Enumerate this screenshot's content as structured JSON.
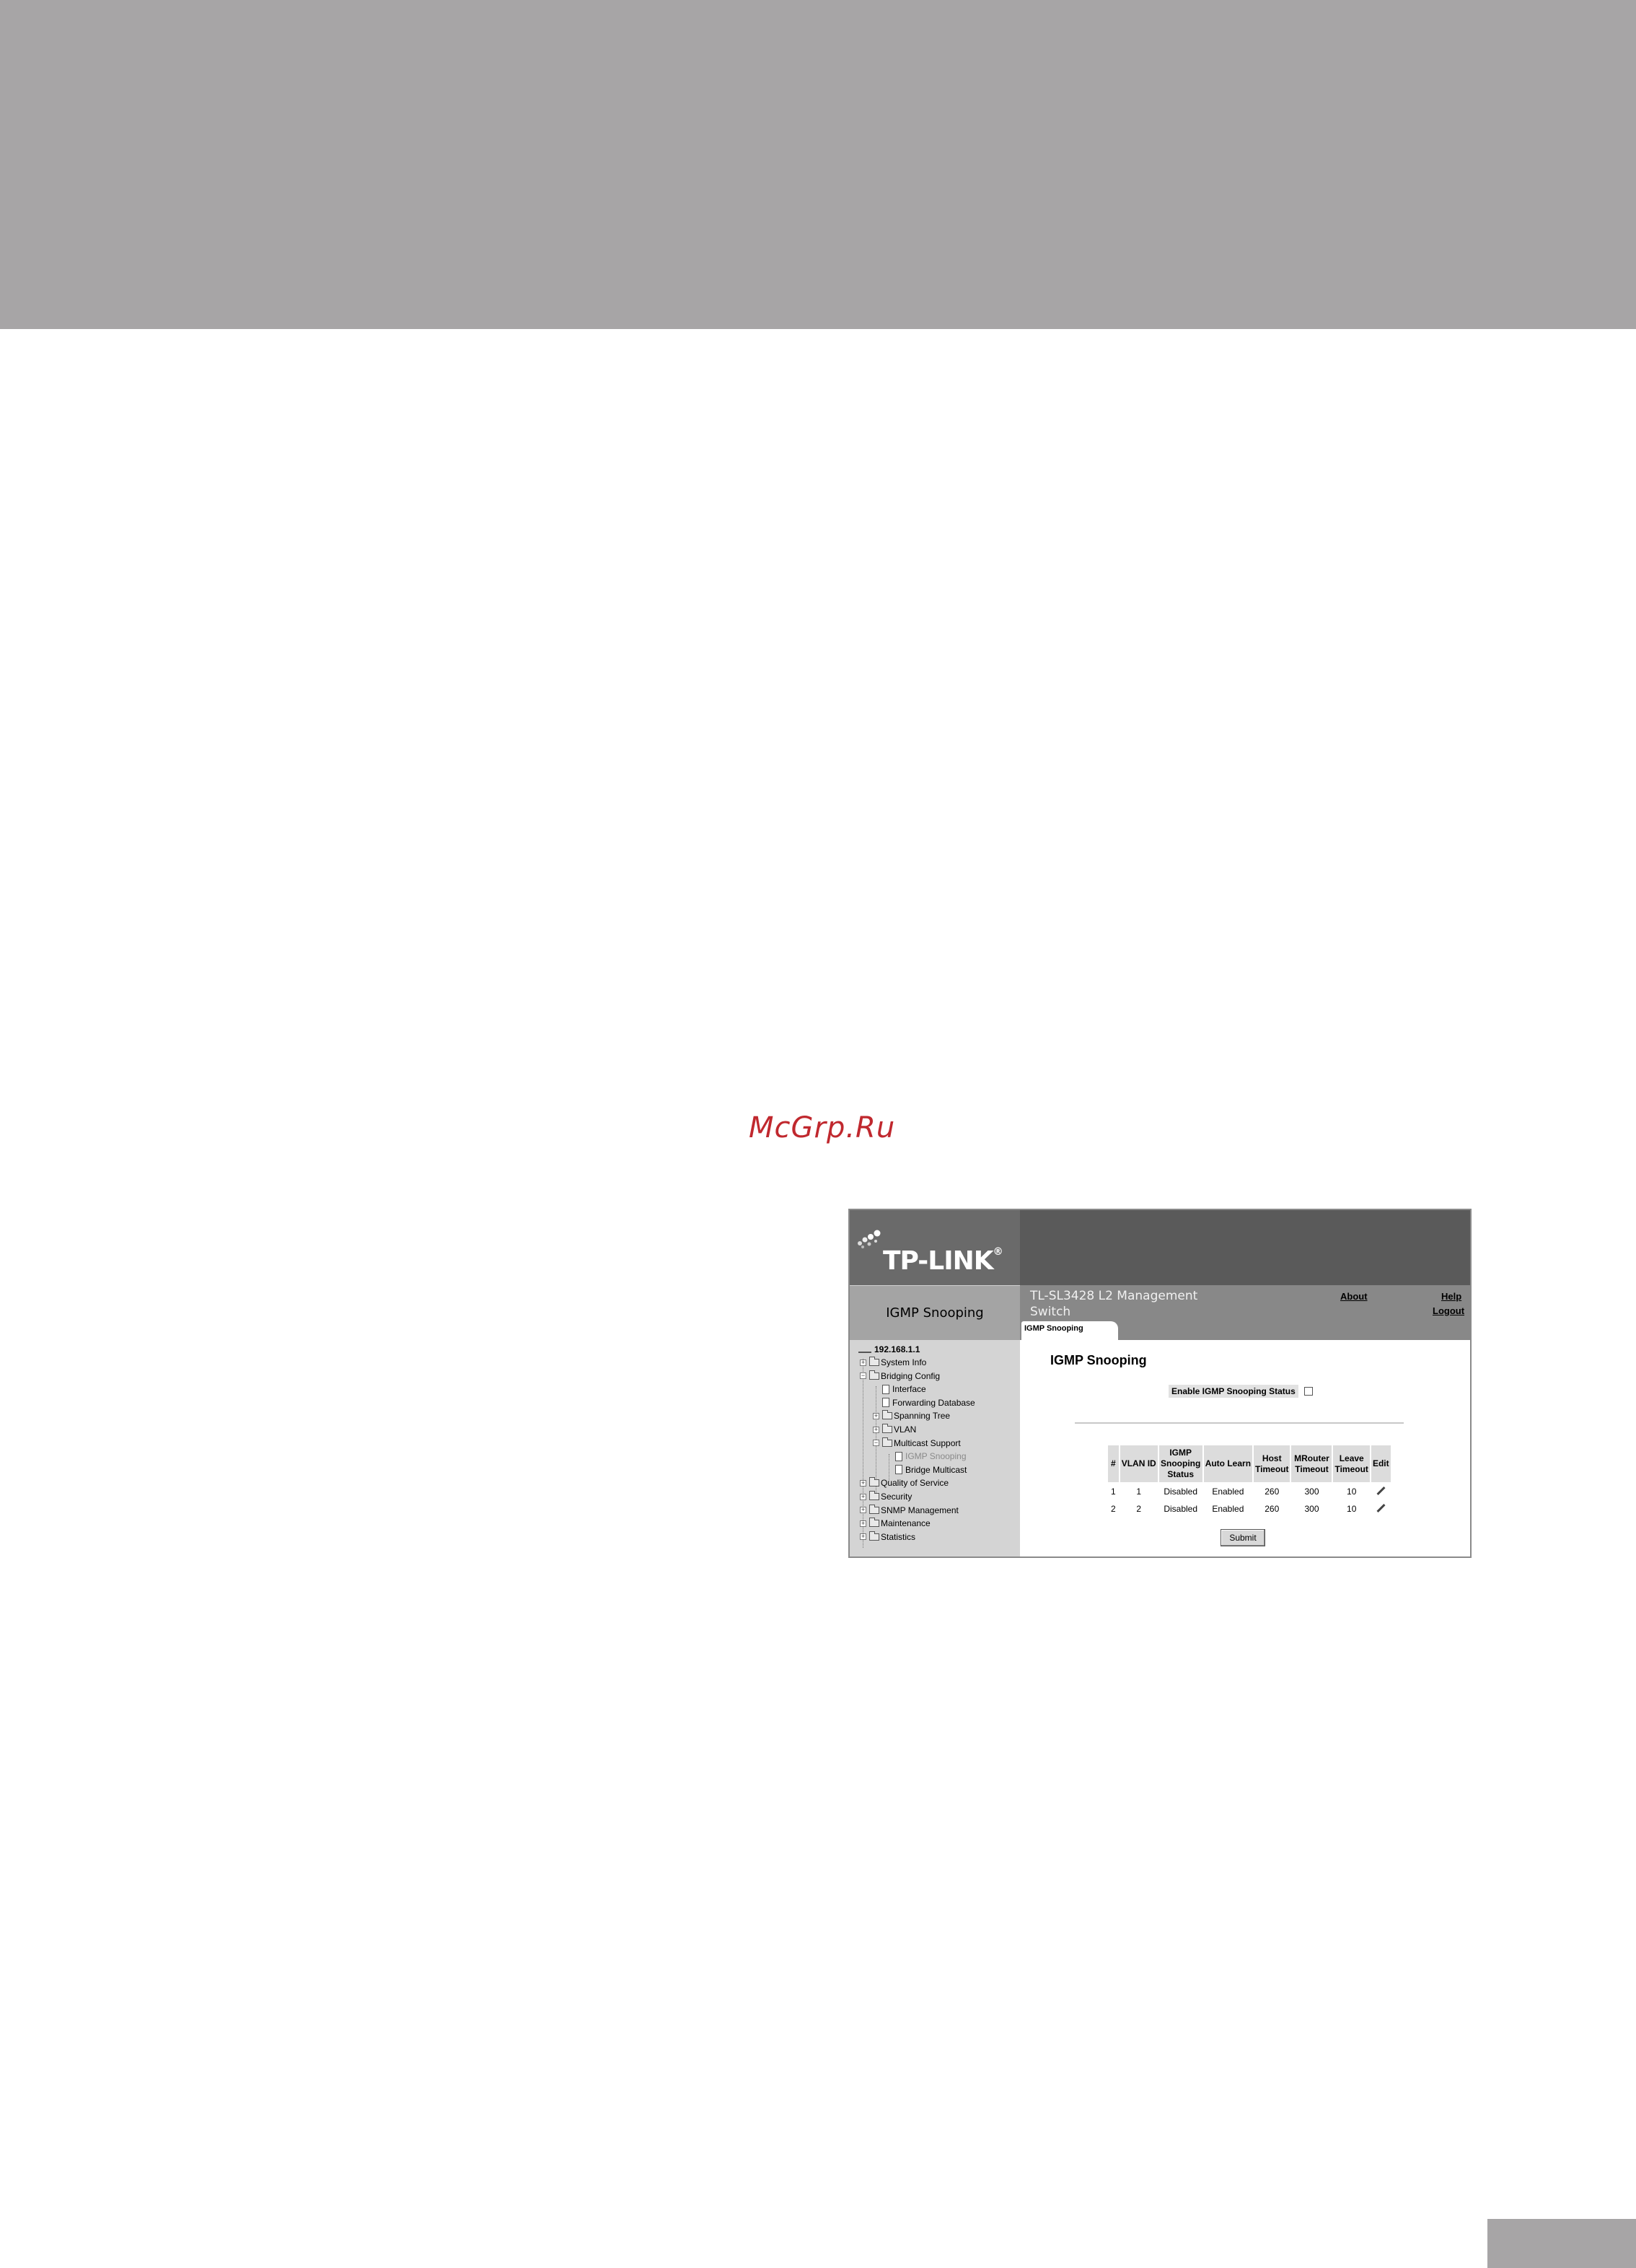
{
  "watermark": "McGrp.Ru",
  "app": {
    "logo": "TP-LINK",
    "logo_mark": "®",
    "page_name": "IGMP Snooping",
    "product": "TL-SL3428 L2 Management Switch",
    "links": {
      "about": "About",
      "help": "Help",
      "logout": "Logout"
    },
    "tab": "IGMP Snooping"
  },
  "sidebar": {
    "root": "192.168.1.1",
    "items": [
      {
        "label": "System Info",
        "level": 0,
        "type": "folder",
        "expander": "+"
      },
      {
        "label": "Bridging Config",
        "level": 0,
        "type": "folder",
        "expander": "−"
      },
      {
        "label": "Interface",
        "level": 1,
        "type": "page"
      },
      {
        "label": "Forwarding Database",
        "level": 1,
        "type": "page"
      },
      {
        "label": "Spanning Tree",
        "level": 1,
        "type": "folder",
        "expander": "+"
      },
      {
        "label": "VLAN",
        "level": 1,
        "type": "folder",
        "expander": "+"
      },
      {
        "label": "Multicast Support",
        "level": 1,
        "type": "folder",
        "expander": "−"
      },
      {
        "label": "IGMP Snooping",
        "level": 2,
        "type": "page",
        "selected": true
      },
      {
        "label": "Bridge Multicast",
        "level": 2,
        "type": "page"
      },
      {
        "label": "Quality of Service",
        "level": 0,
        "type": "folder",
        "expander": "+"
      },
      {
        "label": "Security",
        "level": 0,
        "type": "folder",
        "expander": "+"
      },
      {
        "label": "SNMP Management",
        "level": 0,
        "type": "folder",
        "expander": "+"
      },
      {
        "label": "Maintenance",
        "level": 0,
        "type": "folder",
        "expander": "+"
      },
      {
        "label": "Statistics",
        "level": 0,
        "type": "folder",
        "expander": "+"
      }
    ]
  },
  "main": {
    "title": "IGMP Snooping",
    "enable_label": "Enable IGMP Snooping Status",
    "enable_checked": false,
    "table": {
      "headers": [
        "#",
        "VLAN ID",
        "IGMP Snooping Status",
        "Auto Learn",
        "Host Timeout",
        "MRouter Timeout",
        "Leave Timeout",
        "Edit"
      ],
      "rows": [
        [
          "1",
          "1",
          "Disabled",
          "Enabled",
          "260",
          "300",
          "10"
        ],
        [
          "2",
          "2",
          "Disabled",
          "Enabled",
          "260",
          "300",
          "10"
        ]
      ]
    },
    "submit_label": "Submit"
  },
  "colors": {
    "band": "#a7a5a6",
    "watermark": "#c0282e"
  }
}
